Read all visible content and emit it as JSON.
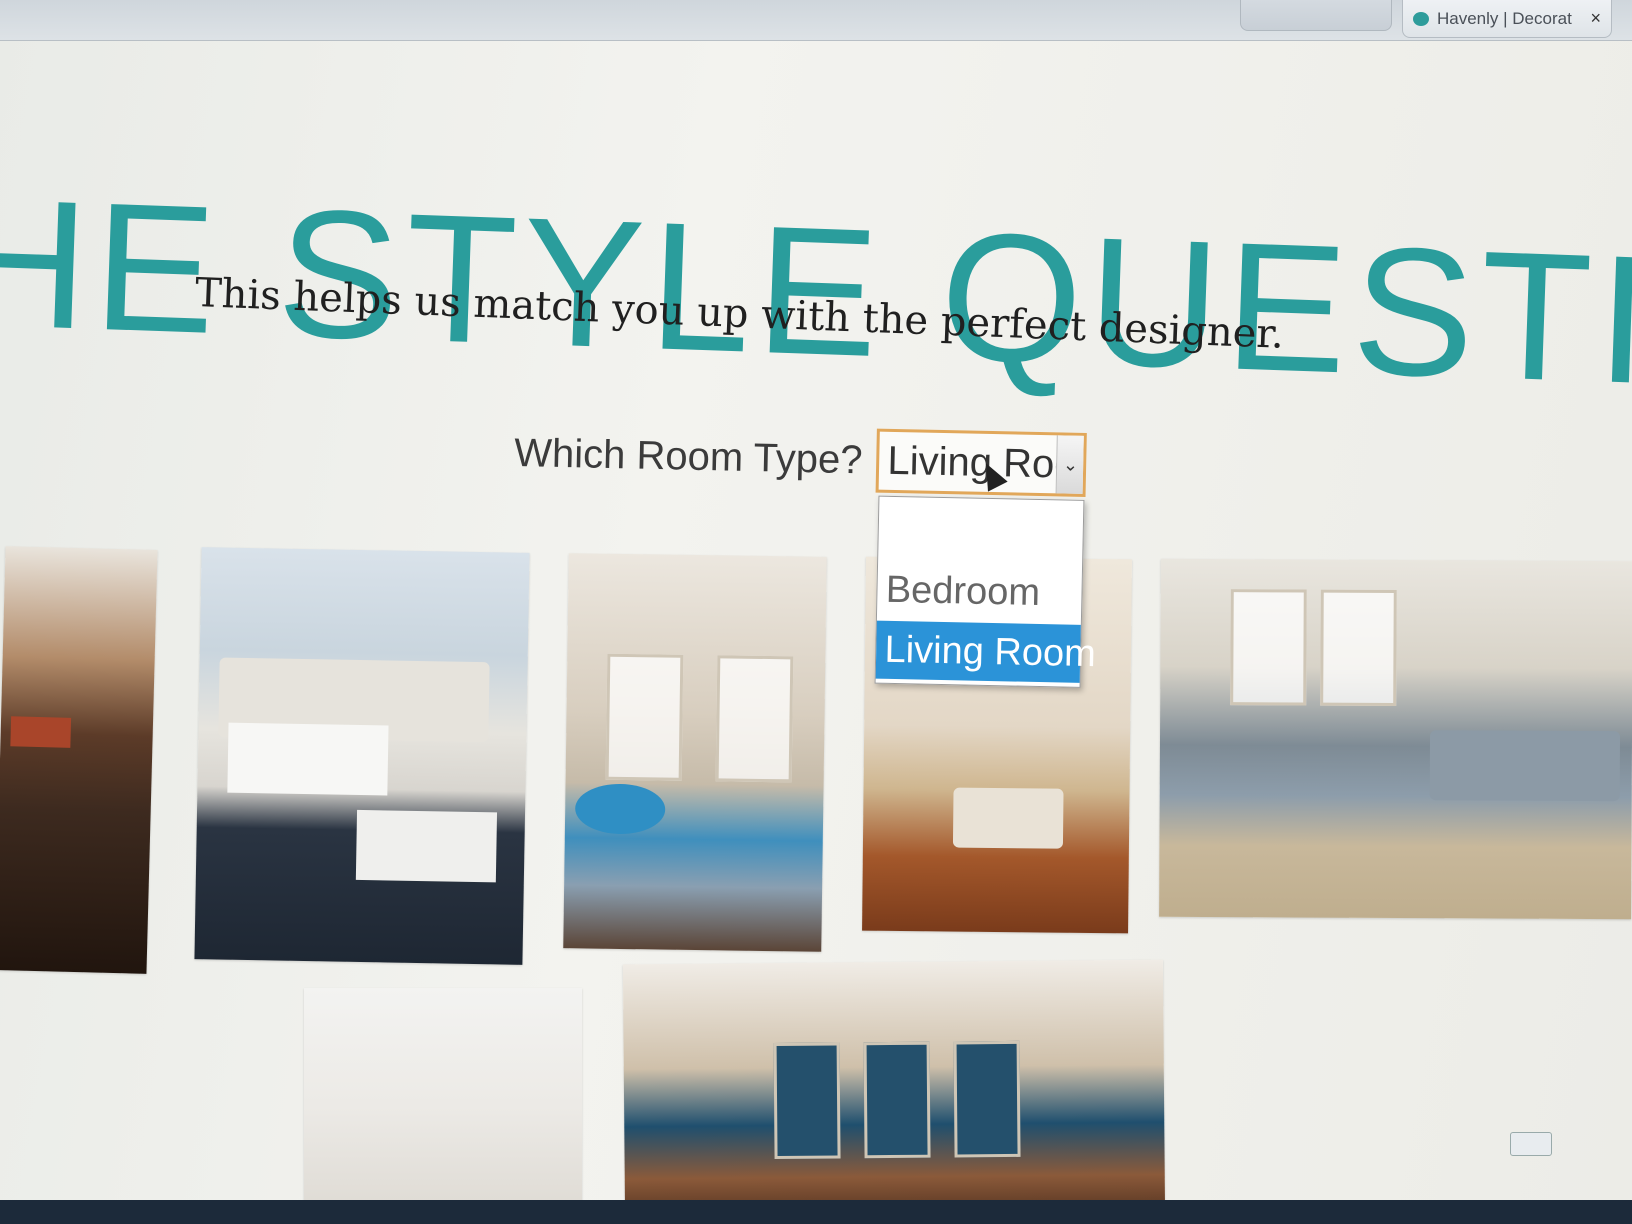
{
  "browser": {
    "tab_title": "Havenly | Decorat",
    "tab_close": "×"
  },
  "page": {
    "title": "HE STYLE QUESTION",
    "subtitle": "This helps us match you up with the perfect designer."
  },
  "room_type": {
    "label": "Which Room Type?",
    "selected": "Living Room",
    "options": [
      "Bedroom",
      "Living Room"
    ],
    "highlighted_option": "Living Room"
  },
  "photos": [
    {
      "id": "photo-1",
      "subject": "dark wood living room"
    },
    {
      "id": "photo-2",
      "subject": "white sectional living room"
    },
    {
      "id": "photo-3",
      "subject": "blue accent living room"
    },
    {
      "id": "photo-4",
      "subject": "cottage living room"
    },
    {
      "id": "photo-5",
      "subject": "sunroom living room"
    },
    {
      "id": "photo-6",
      "subject": "bright white room"
    },
    {
      "id": "photo-7",
      "subject": "open plan dining room"
    }
  ],
  "colors": {
    "title": "#2a9d9c",
    "select_border": "#e1a75a",
    "option_highlight": "#2b93d8"
  },
  "icons": {
    "favicon": "havenly-favicon-icon",
    "dropdown_arrow": "chevron-down-icon",
    "cursor": "mouse-cursor-icon"
  }
}
